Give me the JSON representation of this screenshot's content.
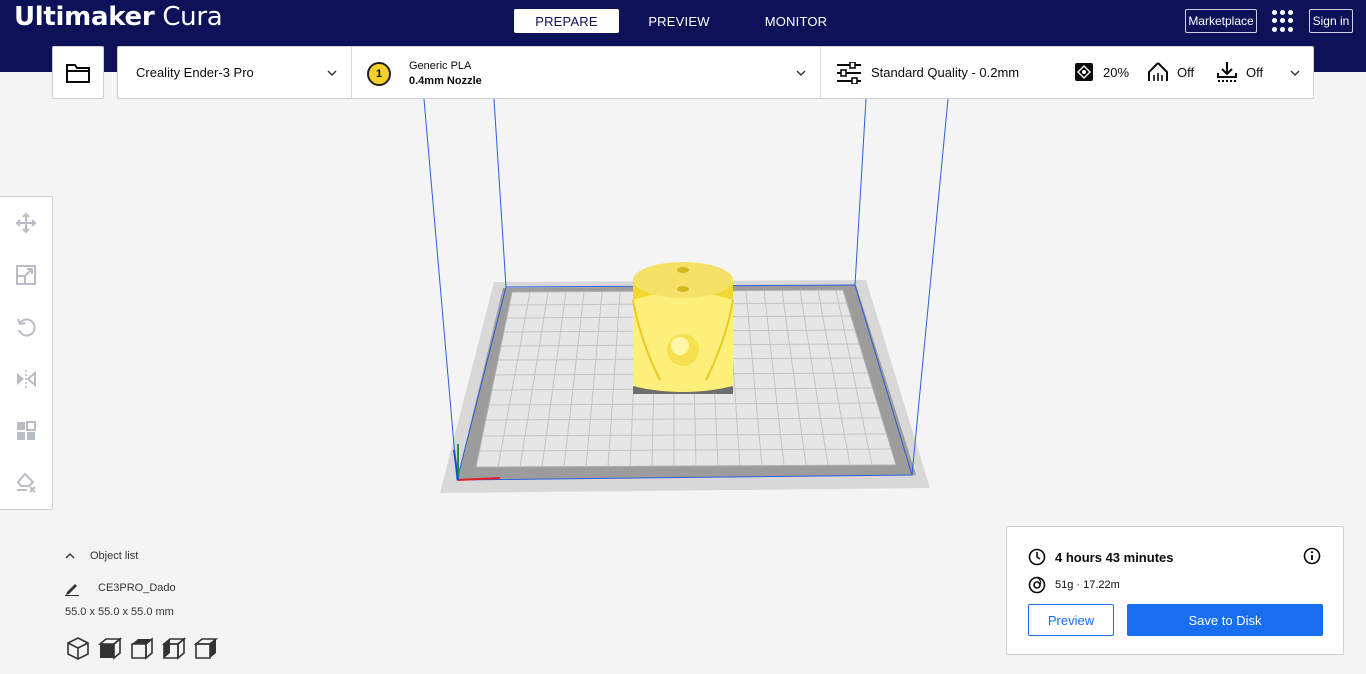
{
  "app": {
    "title_bold": "Ultimaker",
    "title_light": "Cura"
  },
  "header": {
    "tabs": [
      {
        "label": "PREPARE",
        "active": true
      },
      {
        "label": "PREVIEW"
      },
      {
        "label": "MONITOR"
      }
    ],
    "marketplace_label": "Marketplace",
    "signin_label": "Sign in"
  },
  "settings": {
    "printer": "Creality Ender-3 Pro",
    "extruder_number": "1",
    "material": "Generic PLA",
    "nozzle": "0.4mm Nozzle",
    "quality": "Standard Quality - 0.2mm",
    "infill": "20%",
    "support": "Off",
    "adhesion": "Off"
  },
  "object_list": {
    "title": "Object list",
    "item": "CE3PRO_Dado",
    "dimensions": "55.0 x 55.0 x 55.0 mm"
  },
  "action_panel": {
    "print_time": "4 hours 43 minutes",
    "material_usage": "51g · 17.22m",
    "preview_label": "Preview",
    "save_label": "Save to Disk"
  },
  "colors": {
    "header_bg": "#0c1158",
    "accent": "#196ef0",
    "model": "#f8e858"
  }
}
